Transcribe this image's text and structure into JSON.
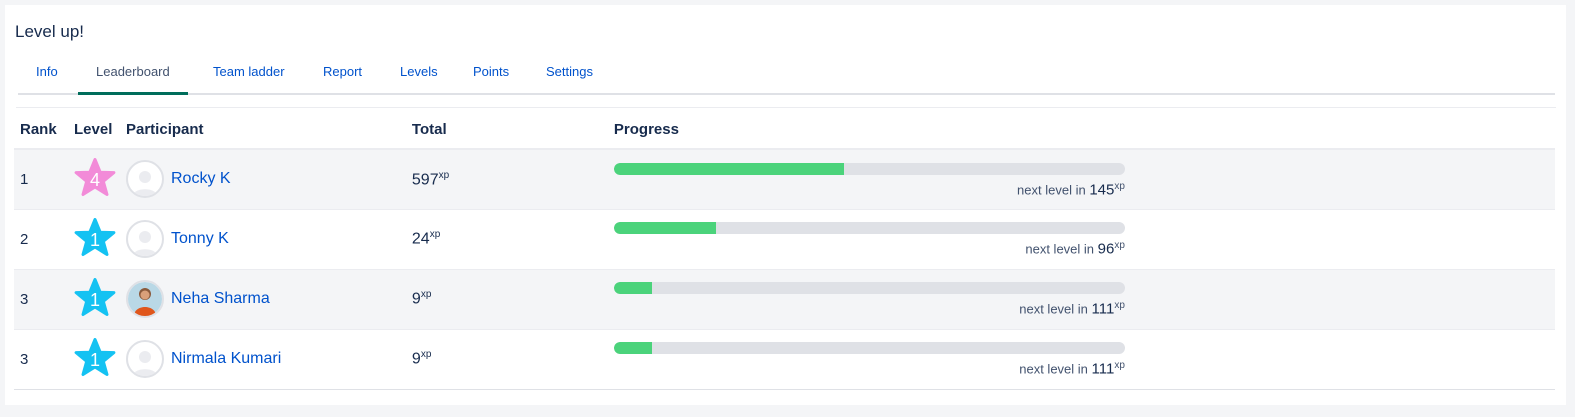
{
  "app": {
    "title": "Level up!"
  },
  "tabs": [
    {
      "label": "Info",
      "active": false
    },
    {
      "label": "Leaderboard",
      "active": true
    },
    {
      "label": "Team ladder",
      "active": false
    },
    {
      "label": "Report",
      "active": false
    },
    {
      "label": "Levels",
      "active": false
    },
    {
      "label": "Points",
      "active": false
    },
    {
      "label": "Settings",
      "active": false
    }
  ],
  "table": {
    "headers": {
      "rank": "Rank",
      "level": "Level",
      "participant": "Participant",
      "total": "Total",
      "progress": "Progress"
    },
    "next_level_label": "next level in",
    "xp_unit": "xp",
    "rows": [
      {
        "rank": "1",
        "level": "4",
        "star_color": "#f28bd8",
        "name": "Rocky K",
        "avatar": "default-avatar-icon",
        "total": "597",
        "progress": 0.45,
        "next": "145"
      },
      {
        "rank": "2",
        "level": "1",
        "star_color": "#14c2f2",
        "name": "Tonny K",
        "avatar": "default-avatar-icon",
        "total": "24",
        "progress": 0.2,
        "next": "96"
      },
      {
        "rank": "3",
        "level": "1",
        "star_color": "#14c2f2",
        "name": "Neha Sharma",
        "avatar": "photo-avatar",
        "total": "9",
        "progress": 0.075,
        "next": "111"
      },
      {
        "rank": "3",
        "level": "1",
        "star_color": "#14c2f2",
        "name": "Nirmala Kumari",
        "avatar": "default-avatar-icon",
        "total": "9",
        "progress": 0.075,
        "next": "111"
      }
    ]
  },
  "colors": {
    "progress_fill": "#4bd37b",
    "progress_track": "#dfe1e6",
    "active_tab_underline": "#006d5b",
    "link": "#0052cc"
  }
}
